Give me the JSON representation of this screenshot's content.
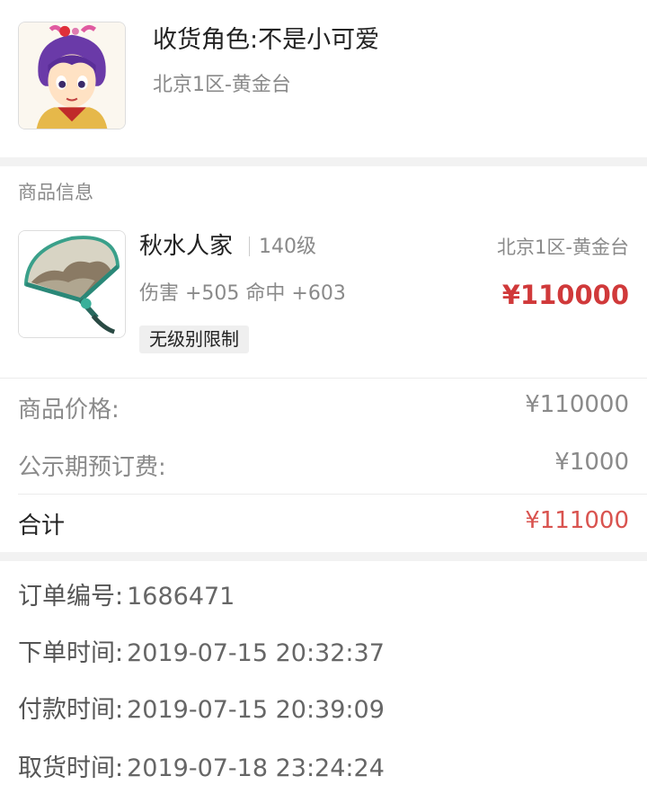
{
  "receiver": {
    "role_label": "收货角色:不是小可爱",
    "server": "北京1区-黄金台"
  },
  "item_section": {
    "label": "商品信息",
    "name": "秋水人家",
    "level": "140级",
    "server": "北京1区-黄金台",
    "stats": "伤害 +505 命中 +603",
    "price": "¥110000",
    "tag": "无级别限制"
  },
  "pricing": {
    "rows": [
      {
        "label": "商品价格:",
        "value": "¥110000"
      },
      {
        "label": "公示期预订费:",
        "value": "¥1000"
      }
    ],
    "total": {
      "label": "合计",
      "value": "¥111000"
    }
  },
  "order": {
    "fields": [
      {
        "label": "订单编号:",
        "value": "1686471"
      },
      {
        "label": "下单时间:",
        "value": "2019-07-15 20:32:37"
      },
      {
        "label": "付款时间:",
        "value": "2019-07-15 20:39:09"
      },
      {
        "label": "取货时间:",
        "value": "2019-07-18 23:24:24"
      }
    ]
  },
  "colors": {
    "price_red": "#d0393a",
    "total_red": "#d9534f",
    "muted_gray": "#8a8a8a",
    "band_gray": "#f2f2f2"
  },
  "icons": {
    "avatar": "character-portrait",
    "item": "fan-weapon-image"
  }
}
